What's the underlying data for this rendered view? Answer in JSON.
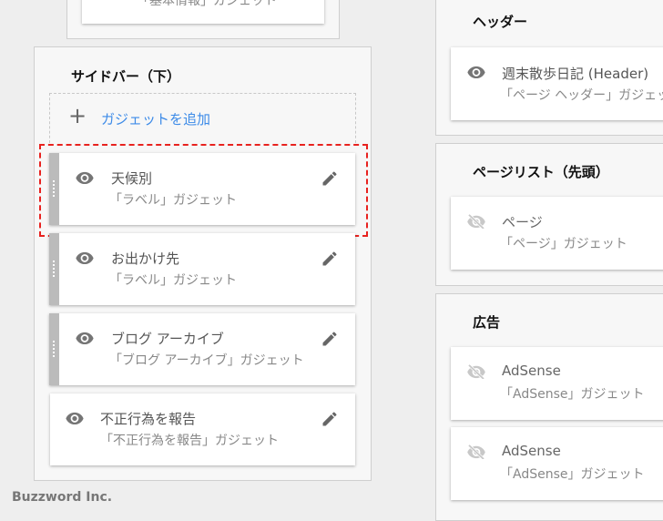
{
  "left_column": {
    "top_card_subtitle": "「基本情報」ガジェット",
    "sidebar_bottom": {
      "title": "サイドバー（下）",
      "add_gadget_label": "ガジェットを追加",
      "gadgets": [
        {
          "title": "天候別",
          "type": "「ラベル」ガジェット",
          "visible": true,
          "highlighted": true
        },
        {
          "title": "お出かけ先",
          "type": "「ラベル」ガジェット",
          "visible": true
        },
        {
          "title": "ブログ アーカイブ",
          "type": "「ブログ アーカイブ」ガジェット",
          "visible": true
        },
        {
          "title": "不正行為を報告",
          "type": "「不正行為を報告」ガジェット",
          "visible": true
        }
      ]
    }
  },
  "right_column": {
    "header": {
      "title": "ヘッダー",
      "gadgets": [
        {
          "title": "週末散歩日記 (Header)",
          "type": "「ページ ヘッダー」ガジェット",
          "visible": true
        }
      ]
    },
    "page_list": {
      "title": "ページリスト（先頭）",
      "gadgets": [
        {
          "title": "ページ",
          "type": "「ページ」ガジェット",
          "visible": false
        }
      ]
    },
    "ads": {
      "title": "広告",
      "gadgets": [
        {
          "title": "AdSense",
          "type": "「AdSense」ガジェット",
          "visible": false
        },
        {
          "title": "AdSense",
          "type": "「AdSense」ガジェット",
          "visible": false
        }
      ]
    }
  },
  "footer": {
    "text": "Buzzword Inc."
  },
  "colors": {
    "link": "#3d8be8",
    "highlight": "#e8221f",
    "icon": "#757575",
    "icon_hidden": "#c8c8c8"
  }
}
